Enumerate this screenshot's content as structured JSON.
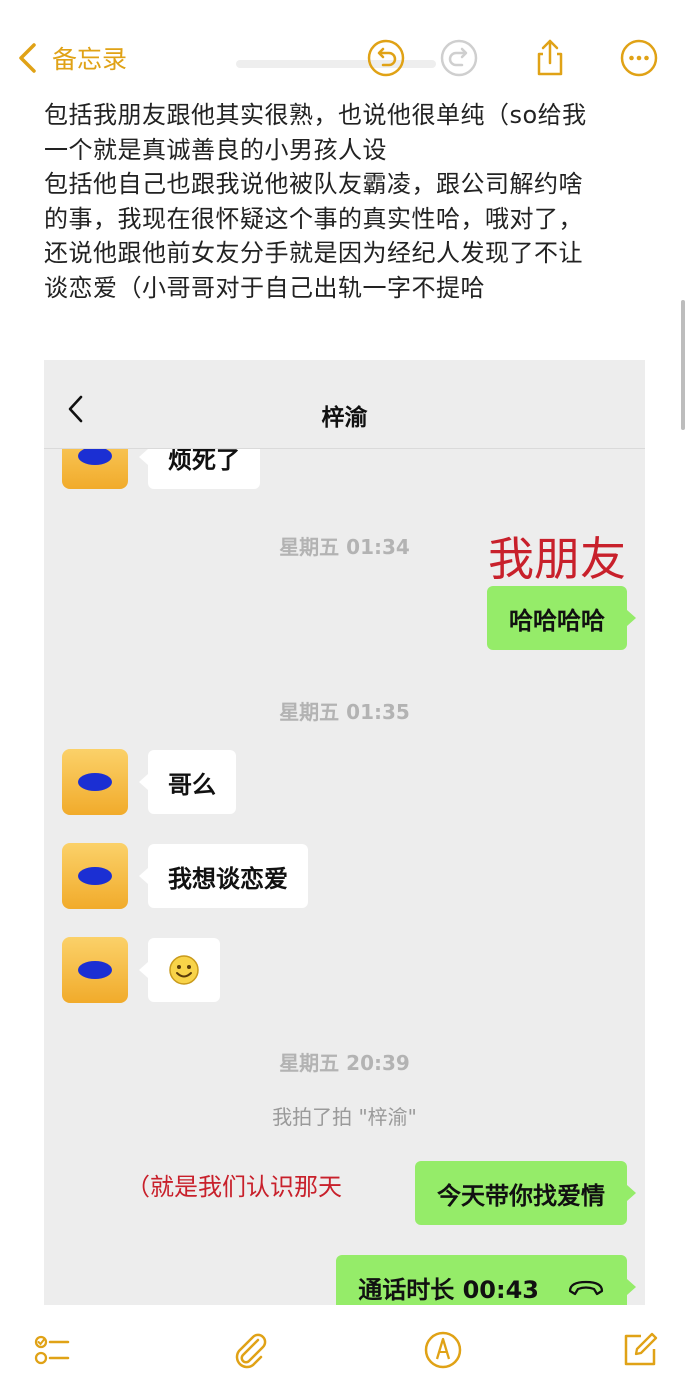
{
  "topbar": {
    "back_label": "备忘录"
  },
  "note": {
    "lines": [
      "包括我朋友跟他其实很熟，也说他很单纯（so给我",
      "一个就是真诚善良的小男孩人设",
      "包括他自己也跟我说他被队友霸凌，跟公司解约啥",
      "的事，我现在很怀疑这个事的真实性哈，哦对了，",
      "还说他跟他前女友分手就是因为经纪人发现了不让",
      "谈恋爱（小哥哥对于自己出轨一字不提哈"
    ]
  },
  "chat": {
    "title": "梓渝",
    "messages": {
      "m1": "烦死了",
      "ts1": "星期五 01:34",
      "m2": "哈哈哈哈",
      "ts2": "星期五 01:35",
      "m3": "哥么",
      "m4": "我想谈恋爱",
      "ts3": "星期五 20:39",
      "sys1": "我拍了拍 \"梓渝\"",
      "m5": "今天带你找爱情",
      "m6": "通话时长 00:43"
    },
    "annotations": {
      "big": "我朋友",
      "small": "（就是我们认识那天"
    }
  },
  "colors": {
    "accent": "#e0a216",
    "annotation_red": "#c8202b",
    "bubble_green": "#95ec69",
    "chat_bg": "#ededed"
  },
  "icons": [
    "chevron-left-icon",
    "undo-icon",
    "redo-icon",
    "share-icon",
    "more-icon",
    "checklist-icon",
    "paperclip-icon",
    "markup-pen-icon",
    "compose-icon",
    "smiley-emoji-icon",
    "phone-hangup-icon"
  ]
}
